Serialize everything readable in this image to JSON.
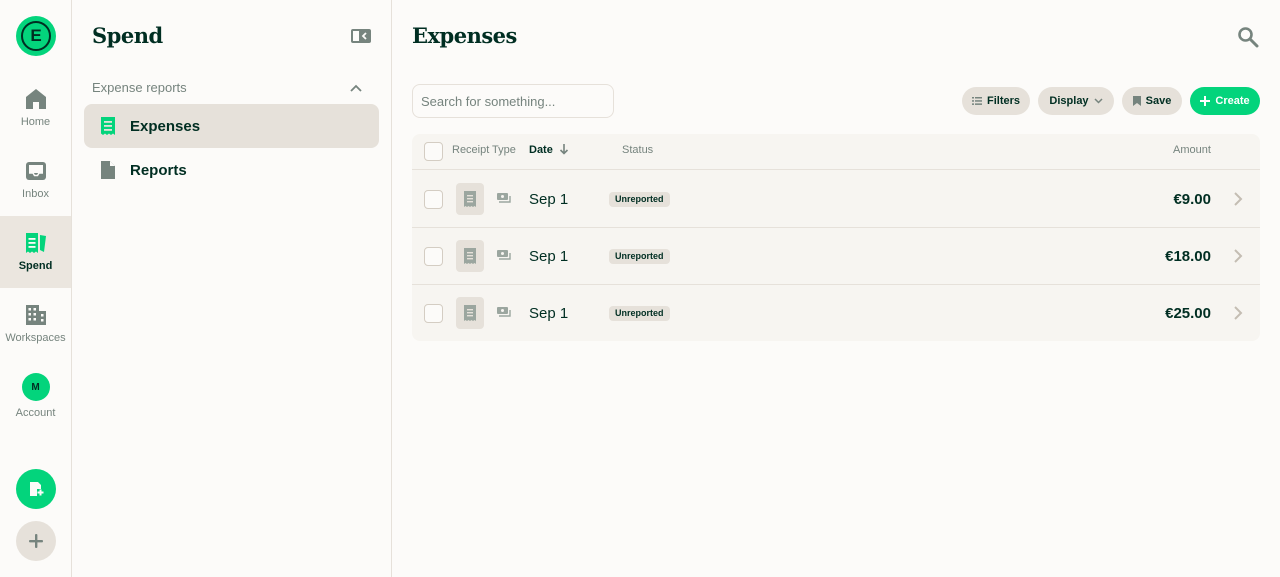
{
  "rail": {
    "logo_letter": "E",
    "items": [
      {
        "label": "Home",
        "icon": "home-icon"
      },
      {
        "label": "Inbox",
        "icon": "inbox-icon"
      },
      {
        "label": "Spend",
        "icon": "receipt-icon",
        "active": true
      },
      {
        "label": "Workspaces",
        "icon": "building-icon"
      },
      {
        "label": "Account",
        "icon": "avatar",
        "initial": "M"
      }
    ],
    "fab_new": "new-expense-icon",
    "fab_add": "plus-icon"
  },
  "side": {
    "title": "Spend",
    "section": "Expense reports",
    "items": [
      {
        "label": "Expenses",
        "icon": "receipt-icon",
        "active": true
      },
      {
        "label": "Reports",
        "icon": "document-icon"
      }
    ]
  },
  "main": {
    "title": "Expenses",
    "search_placeholder": "Search for something...",
    "buttons": {
      "filters": "Filters",
      "display": "Display",
      "save": "Save",
      "create": "Create"
    },
    "columns": {
      "receipt": "Receipt",
      "type": "Type",
      "date": "Date",
      "status": "Status",
      "amount": "Amount"
    },
    "rows": [
      {
        "date": "Sep 1",
        "status": "Unreported",
        "amount": "€9.00"
      },
      {
        "date": "Sep 1",
        "status": "Unreported",
        "amount": "€18.00"
      },
      {
        "date": "Sep 1",
        "status": "Unreported",
        "amount": "€25.00"
      }
    ]
  },
  "colors": {
    "accent": "#03d47c",
    "text": "#002e22",
    "muted": "#76847e",
    "border": "#e6e1da",
    "background": "#fcfbf9"
  }
}
